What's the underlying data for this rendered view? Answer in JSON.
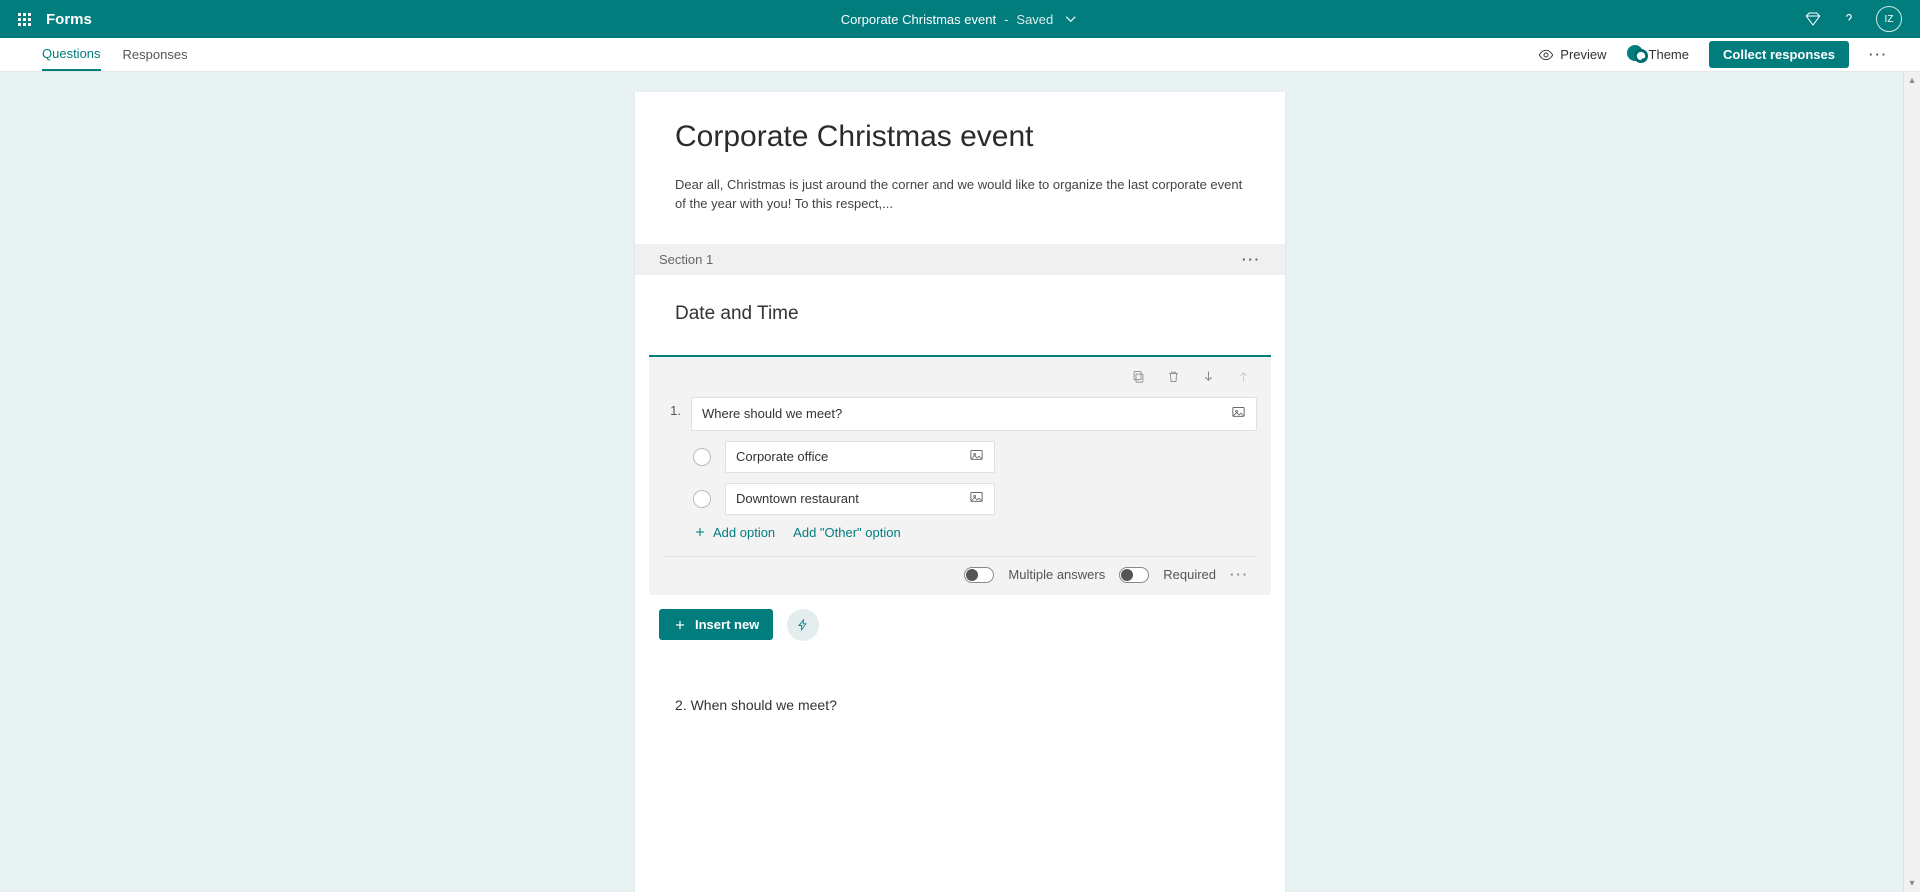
{
  "top": {
    "app_name": "Forms",
    "form_title": "Corporate Christmas event",
    "status_sep": "-",
    "status": "Saved",
    "avatar_initials": "IZ"
  },
  "cmd": {
    "tab_questions": "Questions",
    "tab_responses": "Responses",
    "preview": "Preview",
    "theme": "Theme",
    "collect": "Collect responses"
  },
  "form": {
    "title": "Corporate Christmas event",
    "description": "Dear all, Christmas is just around the corner and we would like to organize the last corporate event of the year with you! To this respect,...",
    "section_label": "Section 1",
    "section_title": "Date and Time"
  },
  "q1": {
    "number": "1.",
    "text": "Where should we meet?",
    "options": [
      "Corporate office",
      "Downtown restaurant"
    ],
    "add_option": "Add option",
    "add_other": "Add \"Other\" option",
    "multiple_label": "Multiple answers",
    "required_label": "Required"
  },
  "insert": {
    "label": "Insert new"
  },
  "q2": {
    "number": "2.",
    "text": "When should we meet?"
  }
}
